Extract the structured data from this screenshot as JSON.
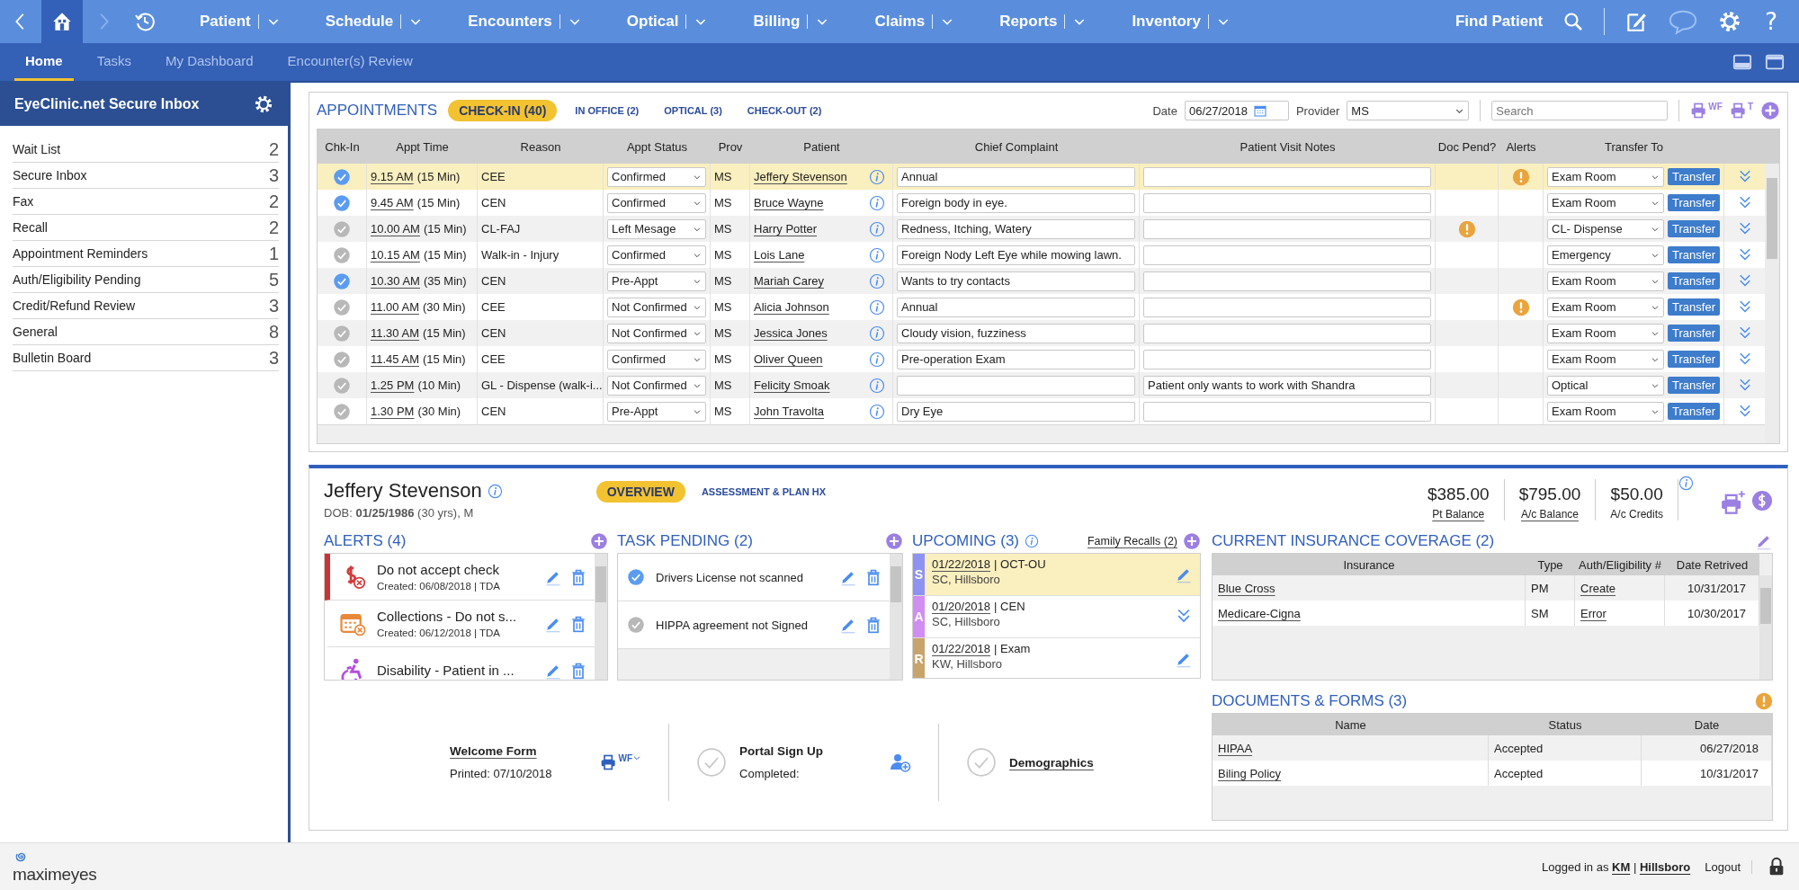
{
  "nav": {
    "menus": [
      {
        "label": "Patient"
      },
      {
        "label": "Schedule"
      },
      {
        "label": "Encounters"
      },
      {
        "label": "Optical"
      },
      {
        "label": "Billing"
      },
      {
        "label": "Claims"
      },
      {
        "label": "Reports"
      },
      {
        "label": "Inventory"
      }
    ],
    "find_patient": "Find Patient",
    "help": "?"
  },
  "subtabs": [
    {
      "label": "Home",
      "selected": true
    },
    {
      "label": "Tasks",
      "selected": false
    },
    {
      "label": "My Dashboard",
      "selected": false
    },
    {
      "label": "Encounter(s) Review",
      "selected": false
    }
  ],
  "sidebar": {
    "title": "EyeClinic.net Secure Inbox",
    "items": [
      {
        "label": "Wait List",
        "count": "2"
      },
      {
        "label": "Secure Inbox",
        "count": "3"
      },
      {
        "label": "Fax",
        "count": "2"
      },
      {
        "label": "Recall",
        "count": "2"
      },
      {
        "label": "Appointment Reminders",
        "count": "1"
      },
      {
        "label": "Auth/Eligibility Pending",
        "count": "5"
      },
      {
        "label": "Credit/Refund Review",
        "count": "3"
      },
      {
        "label": "General",
        "count": "8"
      },
      {
        "label": "Bulletin Board",
        "count": "3"
      }
    ]
  },
  "appointments": {
    "title": "APPOINTMENTS",
    "filters": [
      {
        "label": "CHECK-IN (40)",
        "selected": true
      },
      {
        "label": "IN OFFICE (2)",
        "selected": false
      },
      {
        "label": "OPTICAL (3)",
        "selected": false
      },
      {
        "label": "CHECK-OUT (2)",
        "selected": false
      }
    ],
    "date_label": "Date",
    "date": "06/27/2018",
    "provider_label": "Provider",
    "provider": "MS",
    "search_placeholder": "Search",
    "print_buttons": [
      {
        "superscript": "WF"
      },
      {
        "superscript": "T"
      }
    ],
    "columns": [
      "Chk-In",
      "Appt Time",
      "Reason",
      "Appt Status",
      "Prov",
      "Patient",
      "Chief Complaint",
      "Patient Visit Notes",
      "Doc Pend?",
      "Alerts",
      "Transfer To"
    ],
    "rows": [
      {
        "checked_in": true,
        "time": "9.15 AM",
        "duration": "(15 Min)",
        "reason": "CEE",
        "status": "Confirmed",
        "prov": "MS",
        "patient": "Jeffery Stevenson",
        "complaint": "Annual",
        "doc_pending": false,
        "alert": true,
        "transfer_to": "Exam Room",
        "transfer": "Transfer",
        "selected": true
      },
      {
        "checked_in": true,
        "time": "9.45 AM",
        "duration": "(15 Min)",
        "reason": "CEN",
        "status": "Confirmed",
        "prov": "MS",
        "patient": "Bruce Wayne",
        "complaint": "Foreign body in eye.",
        "doc_pending": false,
        "alert": false,
        "transfer_to": "Exam Room",
        "transfer": "Transfer",
        "selected": false
      },
      {
        "checked_in": false,
        "time": "10.00 AM",
        "duration": "(15 Min)",
        "reason": "CL-FAJ",
        "status": "Left Mesage",
        "prov": "MS",
        "patient": "Harry Potter",
        "complaint": "Redness, Itching, Watery",
        "doc_pending": true,
        "alert": false,
        "transfer_to": "CL- Dispense",
        "transfer": "Transfer",
        "selected": false
      },
      {
        "checked_in": false,
        "time": "10.15 AM",
        "duration": "(15 Min)",
        "reason": "Walk-in - Injury",
        "status": "Confirmed",
        "prov": "MS",
        "patient": "Lois Lane",
        "complaint": "Foreign Nody Left Eye while mowing lawn.",
        "doc_pending": false,
        "alert": false,
        "transfer_to": "Emergency",
        "transfer": "Transfer",
        "selected": false
      },
      {
        "checked_in": true,
        "time": "10.30 AM",
        "duration": "(35 Min)",
        "reason": "CEN",
        "status": "Pre-Appt",
        "prov": "MS",
        "patient": "Mariah Carey",
        "complaint": "Wants to try contacts",
        "doc_pending": false,
        "alert": false,
        "transfer_to": "Exam Room",
        "transfer": "Transfer",
        "selected": false
      },
      {
        "checked_in": false,
        "time": "11.00 AM",
        "duration": "(30 Min)",
        "reason": "CEE",
        "status": "Not Confirmed",
        "prov": "MS",
        "patient": "Alicia Johnson",
        "complaint": "Annual",
        "doc_pending": false,
        "alert": true,
        "transfer_to": "Exam Room",
        "transfer": "Transfer",
        "selected": false
      },
      {
        "checked_in": false,
        "time": "11.30 AM",
        "duration": "(15 Min)",
        "reason": "CEN",
        "status": "Not Confirmed",
        "prov": "MS",
        "patient": "Jessica Jones",
        "complaint": "Cloudy vision, fuzziness",
        "doc_pending": false,
        "alert": false,
        "transfer_to": "Exam Room",
        "transfer": "Transfer",
        "selected": false
      },
      {
        "checked_in": false,
        "time": "11.45 AM",
        "duration": "(15 Min)",
        "reason": "CEE",
        "status": "Confirmed",
        "prov": "MS",
        "patient": "Oliver Queen",
        "complaint": "Pre-operation Exam",
        "doc_pending": false,
        "alert": false,
        "transfer_to": "Exam Room",
        "transfer": "Transfer",
        "selected": false
      },
      {
        "checked_in": false,
        "time": "1.25 PM",
        "duration": "(10 Min)",
        "reason": "GL - Dispense (walk-i...",
        "status": "Not Confirmed",
        "prov": "MS",
        "patient": "Felicity Smoak",
        "notes": "Patient only wants to work with Shandra",
        "doc_pending": false,
        "alert": false,
        "transfer_to": "Optical",
        "transfer": "Transfer",
        "selected": false
      },
      {
        "checked_in": false,
        "time": "1.30 PM",
        "duration": "(30 Min)",
        "reason": "CEN",
        "status": "Pre-Appt",
        "prov": "MS",
        "patient": "John Travolta",
        "complaint": "Dry Eye",
        "doc_pending": false,
        "alert": false,
        "transfer_to": "Exam Room",
        "transfer": "Transfer",
        "selected": false
      }
    ]
  },
  "patient": {
    "name": "Jeffery Stevenson",
    "dob": "DOB: **01/25/1986** (30 yrs), M",
    "tabs": [
      {
        "label": "OVERVIEW",
        "selected": true
      },
      {
        "label": "ASSESSMENT & PLAN HX",
        "selected": false
      }
    ],
    "balances": [
      {
        "amount": "$385.00",
        "label": "Pt Balance",
        "link": true
      },
      {
        "amount": "$795.00",
        "label": "A/c Balance",
        "link": true
      },
      {
        "amount": "$50.00",
        "label": "A/c Credits",
        "link": false
      }
    ],
    "alerts": {
      "title": "ALERTS (4)",
      "items": [
        {
          "kind": "payment",
          "title": "Do not accept check",
          "meta": "Created: 06/08/2018 | TDA",
          "flagged": true
        },
        {
          "kind": "calendar",
          "title": "Collections - Do not s...",
          "meta": "Created: 06/12/2018 | TDA",
          "flagged": false
        },
        {
          "kind": "disability",
          "title": "Disability - Patient in ...",
          "flagged": false
        }
      ]
    },
    "tasks": {
      "title": "TASK PENDING (2)",
      "items": [
        {
          "label": "Drivers License not scanned",
          "done": true
        },
        {
          "label": "HIPPA agreement not Signed",
          "done": false
        }
      ]
    },
    "upcoming": {
      "title": "UPCOMING (3)",
      "family_recalls": "Family Recalls (2)",
      "items": [
        {
          "letter": "S",
          "color": "#8e93f2",
          "date": "01/22/2018",
          "detail": "| OCT-OU",
          "location": "SC, Hillsboro",
          "kind": "edit",
          "selected": true
        },
        {
          "letter": "A",
          "color": "#d08ef2",
          "date": "01/20/2018",
          "detail": "| CEN",
          "location": "SC, Hillsboro",
          "kind": "expand",
          "selected": false
        },
        {
          "letter": "R",
          "color": "#c8a46c",
          "date": "01/22/2018",
          "detail": "| Exam",
          "location": "KW, Hillsboro",
          "kind": "edit",
          "selected": false
        }
      ]
    },
    "forms": [
      {
        "kind": "print",
        "title": "Welcome Form",
        "subtitle": "Printed: 07/10/2018",
        "superscript": "WF"
      },
      {
        "kind": "signup",
        "title": "Portal Sign Up",
        "subtitle": "Completed:"
      },
      {
        "kind": "check",
        "title": "Demographics"
      }
    ],
    "insurance": {
      "title": "CURRENT INSURANCE COVERAGE (2)",
      "columns": [
        "Insurance",
        "Type",
        "Auth/Eligibility #",
        "Date Retrived"
      ],
      "rows": [
        {
          "insurance": "Blue Cross",
          "type": "PM",
          "auth": "Create",
          "date": "10/31/2017"
        },
        {
          "insurance": "Medicare-Cigna",
          "type": "SM",
          "auth": "Error",
          "date": "10/30/2017"
        }
      ]
    },
    "documents": {
      "title": "DOCUMENTS & FORMS (3)",
      "columns": [
        "Name",
        "Status",
        "Date"
      ],
      "rows": [
        {
          "name": "HIPAA",
          "status": "Accepted",
          "date": "06/27/2018"
        },
        {
          "name": "Biling Policy",
          "status": "Accepted",
          "date": "10/31/2017"
        }
      ]
    }
  },
  "footer": {
    "logo": "maximeyes",
    "login": "Logged in as **KM** | **Hillsboro**",
    "logout": "Logout"
  }
}
